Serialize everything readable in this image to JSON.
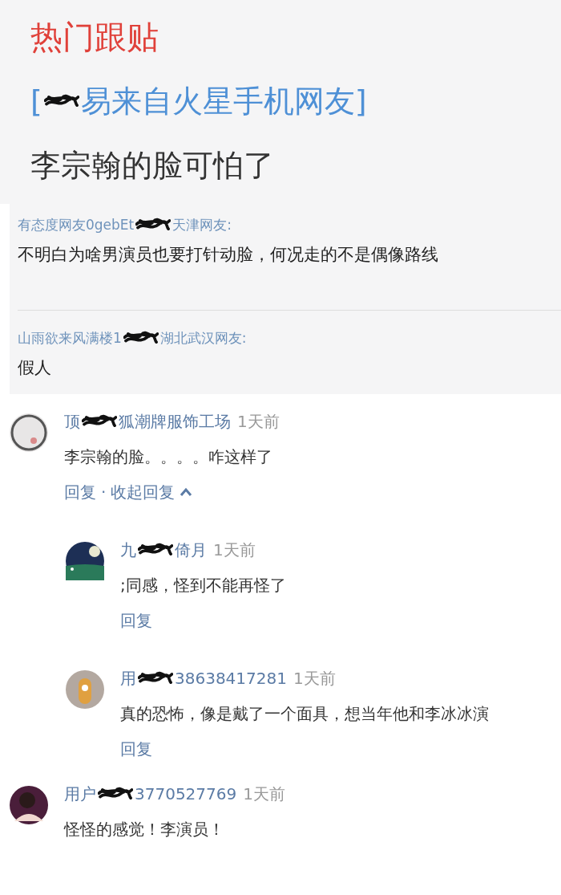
{
  "section_title": "热门跟贴",
  "thread": {
    "source_start": "[",
    "source_end": "易来自火星手机网友]",
    "headline": "李宗翰的脸可怕了"
  },
  "quotes": [
    {
      "author_start": "有态度网友0gebEt",
      "author_end": "天津网友:",
      "text": "不明白为啥男演员也要打针动脸，何况走的不是偶像路线"
    },
    {
      "author_start": "山雨欲来风满楼1",
      "author_end": "湖北武汉网友:",
      "text": "假人"
    }
  ],
  "comments": [
    {
      "name_start": "顶",
      "name_end": "狐潮牌服饰工场",
      "time": "1天前",
      "text": "李宗翰的脸。。。。咋这样了",
      "reply": "回复",
      "separator": "·",
      "toggle": "收起回复",
      "expanded": true,
      "replies": [
        {
          "name_start": "九",
          "name_end": "倚月",
          "time": "1天前",
          "text": ";同感，怪到不能再怪了",
          "reply": "回复"
        },
        {
          "name_start": "用",
          "name_end": "38638417281",
          "time": "1天前",
          "text": "真的恐怖，像是戴了一个面具，想当年他和李冰冰演",
          "reply": "回复"
        }
      ]
    },
    {
      "name_start": "用户",
      "name_end": "3770527769",
      "time": "1天前",
      "text": "怪怪的感觉！李演员！"
    }
  ]
}
